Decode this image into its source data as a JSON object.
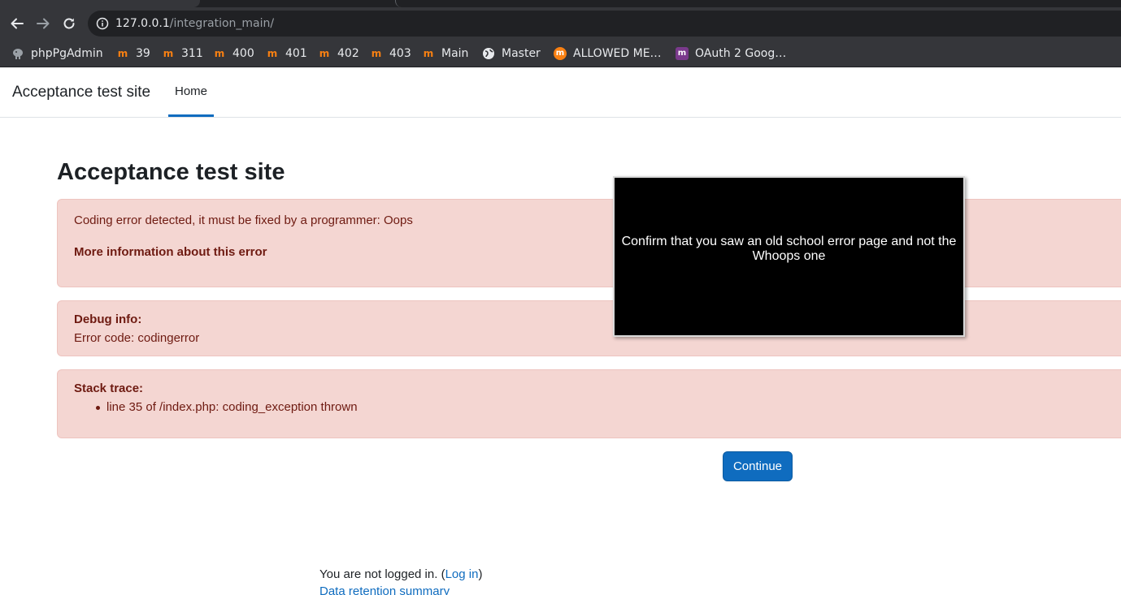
{
  "browser": {
    "url_host": "127.0.0.1",
    "url_path": "/integration_main/",
    "bookmarks": [
      {
        "label": "phpPgAdmin",
        "icon": "elephant-icon"
      },
      {
        "label": "39",
        "icon": "moodle-icon"
      },
      {
        "label": "311",
        "icon": "moodle-icon"
      },
      {
        "label": "400",
        "icon": "moodle-icon"
      },
      {
        "label": "401",
        "icon": "moodle-icon"
      },
      {
        "label": "402",
        "icon": "moodle-icon"
      },
      {
        "label": "403",
        "icon": "moodle-icon"
      },
      {
        "label": "Main",
        "icon": "moodle-icon"
      },
      {
        "label": "Master",
        "icon": "globe-icon"
      },
      {
        "label": "ALLOWED ME…",
        "icon": "moodle-round-icon"
      },
      {
        "label": "OAuth 2 Goog…",
        "icon": "moodle-square-icon"
      }
    ]
  },
  "navbar": {
    "brand": "Acceptance test site",
    "home_label": "Home"
  },
  "main": {
    "title": "Acceptance test site",
    "error_message": "Coding error detected, it must be fixed by a programmer: Oops",
    "more_info": "More information about this error",
    "debug_heading": "Debug info:",
    "debug_text": "Error code: codingerror",
    "stack_heading": "Stack trace:",
    "stack_items": [
      "line 35 of /index.php: coding_exception thrown"
    ],
    "continue_label": "Continue"
  },
  "footer": {
    "not_logged_in": "You are not logged in. (",
    "login_link": "Log in",
    "close_paren": ")",
    "data_retention": "Data retention summary"
  },
  "overlay": {
    "message": "Confirm that you saw an old school error page and not the Whoops one"
  },
  "colors": {
    "accent": "#0f6cbf",
    "alert_bg": "#f4d6d2",
    "alert_text": "#6e1a11"
  }
}
